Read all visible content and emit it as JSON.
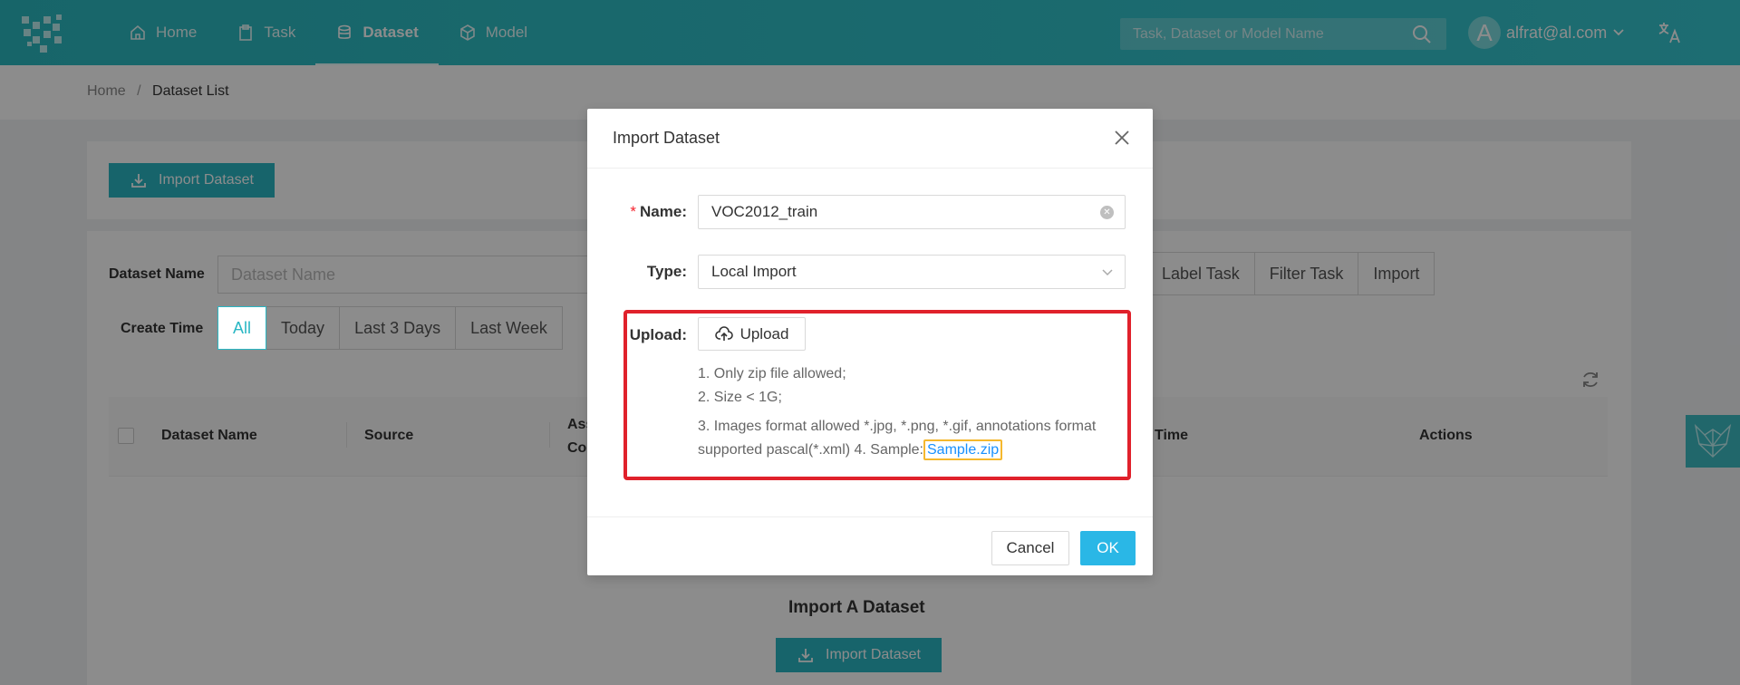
{
  "header": {
    "nav": [
      {
        "label": "Home",
        "icon": "home-icon"
      },
      {
        "label": "Task",
        "icon": "clipboard-icon"
      },
      {
        "label": "Dataset",
        "icon": "database-icon",
        "active": true
      },
      {
        "label": "Model",
        "icon": "cube-icon"
      }
    ],
    "search_placeholder": "Task, Dataset or Model Name",
    "user_initial": "A",
    "user_email": "alfrat@al.com"
  },
  "breadcrumb": {
    "home": "Home",
    "separator": "/",
    "current": "Dataset List"
  },
  "toolbar": {
    "import_label": "Import Dataset"
  },
  "filters": {
    "dataset_name_label": "Dataset Name",
    "dataset_name_placeholder": "Dataset Name",
    "source_options": [
      "Label Task",
      "Filter Task",
      "Import"
    ],
    "create_time_label": "Create Time",
    "time_options": [
      "All",
      "Today",
      "Last 3 Days",
      "Last Week"
    ]
  },
  "table": {
    "columns": [
      "Dataset Name",
      "Source",
      "Ass",
      "Co",
      "Time",
      "Actions"
    ]
  },
  "empty": {
    "title": "Import A Dataset",
    "button_label": "Import Dataset"
  },
  "modal": {
    "title": "Import Dataset",
    "name_label": "Name",
    "name_value": "VOC2012_train",
    "type_label": "Type",
    "type_value": "Local Import",
    "upload_label": "Upload",
    "upload_button": "Upload",
    "hint1": "1. Only zip file allowed;",
    "hint2": "2. Size < 1G;",
    "hint3": "3. Images format allowed *.jpg, *.png, *.gif, annotations format supported pascal(*.xml) 4. Sample:",
    "sample_link": "Sample.zip",
    "cancel_label": "Cancel",
    "ok_label": "OK"
  },
  "colors": {
    "header": "#36c6cf",
    "accent": "#2ab7c4",
    "ok": "#2ab7e6",
    "highlight_box": "#e0212b",
    "link_box": "#f5b82e"
  }
}
